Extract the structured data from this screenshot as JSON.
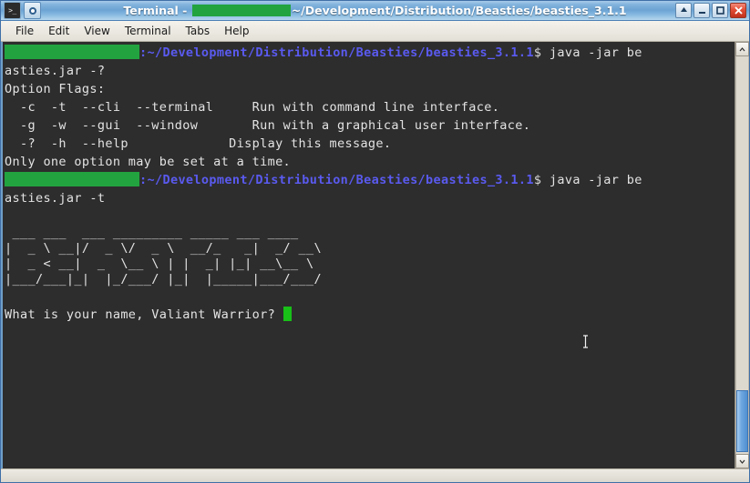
{
  "window": {
    "title_prefix": "Terminal - ",
    "title_path": "~/Development/Distribution/Beasties/beasties_3.1.1",
    "title_redacted": true
  },
  "titlebar_buttons": {
    "shade_label": "shade",
    "minimize_label": "minimize",
    "maximize_label": "maximize",
    "close_label": "close"
  },
  "menubar": {
    "items": [
      {
        "label": "File"
      },
      {
        "label": "Edit"
      },
      {
        "label": "View"
      },
      {
        "label": "Terminal"
      },
      {
        "label": "Tabs"
      },
      {
        "label": "Help"
      }
    ]
  },
  "terminal": {
    "prompt": {
      "path": ":~/Development/Distribution/Beasties/beasties_3.1.1",
      "sigil": "$ "
    },
    "command_1_part1": "java -jar be",
    "command_1_part2": "asties.jar -?",
    "command_2_part1": "java -jar be",
    "command_2_part2": "asties.jar -t",
    "help_header": "Option Flags:",
    "help_rows": [
      {
        "flags": "  -c  -t  --cli  --terminal",
        "desc": "Run with command line interface."
      },
      {
        "flags": "  -g  -w  --gui  --window",
        "desc": "Run with a graphical user interface."
      },
      {
        "flags": "  -?  -h  --help",
        "desc": "Display this message."
      }
    ],
    "help_footer": "Only one option may be set at a time.",
    "banner": [
      " ___ ___  ___ _________ _____ ___ ____",
      "|  _ \\ __|/  _ \\/  _ \\  __/_   _|  _/ __\\",
      "|  _ < __|  _  \\__ \\ | |  _| |_| __\\__ \\",
      "|___/___|_|  |_/___/ |_|  |_____|___/___/"
    ],
    "question": "What is your name, Valiant Warrior? ",
    "colors": {
      "background": "#2d2d2d",
      "foreground": "#e3e3e3",
      "path": "#5a5af0",
      "redaction": "#22a33f",
      "cursor": "#18c018"
    }
  }
}
